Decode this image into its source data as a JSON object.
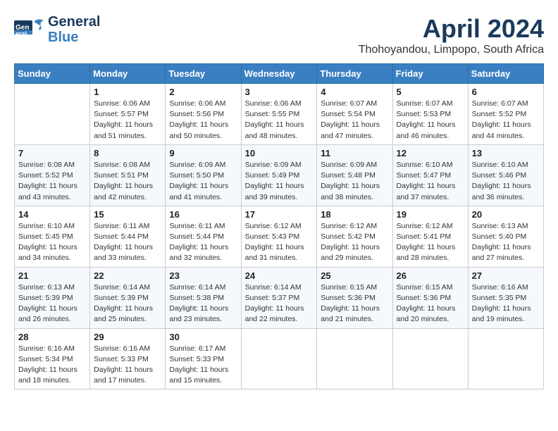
{
  "logo": {
    "line1": "General",
    "line2": "Blue"
  },
  "title": "April 2024",
  "location": "Thohoyandou, Limpopo, South Africa",
  "headers": [
    "Sunday",
    "Monday",
    "Tuesday",
    "Wednesday",
    "Thursday",
    "Friday",
    "Saturday"
  ],
  "weeks": [
    [
      {
        "day": "",
        "info": ""
      },
      {
        "day": "1",
        "info": "Sunrise: 6:06 AM\nSunset: 5:57 PM\nDaylight: 11 hours\nand 51 minutes."
      },
      {
        "day": "2",
        "info": "Sunrise: 6:06 AM\nSunset: 5:56 PM\nDaylight: 11 hours\nand 50 minutes."
      },
      {
        "day": "3",
        "info": "Sunrise: 6:06 AM\nSunset: 5:55 PM\nDaylight: 11 hours\nand 48 minutes."
      },
      {
        "day": "4",
        "info": "Sunrise: 6:07 AM\nSunset: 5:54 PM\nDaylight: 11 hours\nand 47 minutes."
      },
      {
        "day": "5",
        "info": "Sunrise: 6:07 AM\nSunset: 5:53 PM\nDaylight: 11 hours\nand 46 minutes."
      },
      {
        "day": "6",
        "info": "Sunrise: 6:07 AM\nSunset: 5:52 PM\nDaylight: 11 hours\nand 44 minutes."
      }
    ],
    [
      {
        "day": "7",
        "info": "Sunrise: 6:08 AM\nSunset: 5:52 PM\nDaylight: 11 hours\nand 43 minutes."
      },
      {
        "day": "8",
        "info": "Sunrise: 6:08 AM\nSunset: 5:51 PM\nDaylight: 11 hours\nand 42 minutes."
      },
      {
        "day": "9",
        "info": "Sunrise: 6:09 AM\nSunset: 5:50 PM\nDaylight: 11 hours\nand 41 minutes."
      },
      {
        "day": "10",
        "info": "Sunrise: 6:09 AM\nSunset: 5:49 PM\nDaylight: 11 hours\nand 39 minutes."
      },
      {
        "day": "11",
        "info": "Sunrise: 6:09 AM\nSunset: 5:48 PM\nDaylight: 11 hours\nand 38 minutes."
      },
      {
        "day": "12",
        "info": "Sunrise: 6:10 AM\nSunset: 5:47 PM\nDaylight: 11 hours\nand 37 minutes."
      },
      {
        "day": "13",
        "info": "Sunrise: 6:10 AM\nSunset: 5:46 PM\nDaylight: 11 hours\nand 36 minutes."
      }
    ],
    [
      {
        "day": "14",
        "info": "Sunrise: 6:10 AM\nSunset: 5:45 PM\nDaylight: 11 hours\nand 34 minutes."
      },
      {
        "day": "15",
        "info": "Sunrise: 6:11 AM\nSunset: 5:44 PM\nDaylight: 11 hours\nand 33 minutes."
      },
      {
        "day": "16",
        "info": "Sunrise: 6:11 AM\nSunset: 5:44 PM\nDaylight: 11 hours\nand 32 minutes."
      },
      {
        "day": "17",
        "info": "Sunrise: 6:12 AM\nSunset: 5:43 PM\nDaylight: 11 hours\nand 31 minutes."
      },
      {
        "day": "18",
        "info": "Sunrise: 6:12 AM\nSunset: 5:42 PM\nDaylight: 11 hours\nand 29 minutes."
      },
      {
        "day": "19",
        "info": "Sunrise: 6:12 AM\nSunset: 5:41 PM\nDaylight: 11 hours\nand 28 minutes."
      },
      {
        "day": "20",
        "info": "Sunrise: 6:13 AM\nSunset: 5:40 PM\nDaylight: 11 hours\nand 27 minutes."
      }
    ],
    [
      {
        "day": "21",
        "info": "Sunrise: 6:13 AM\nSunset: 5:39 PM\nDaylight: 11 hours\nand 26 minutes."
      },
      {
        "day": "22",
        "info": "Sunrise: 6:14 AM\nSunset: 5:39 PM\nDaylight: 11 hours\nand 25 minutes."
      },
      {
        "day": "23",
        "info": "Sunrise: 6:14 AM\nSunset: 5:38 PM\nDaylight: 11 hours\nand 23 minutes."
      },
      {
        "day": "24",
        "info": "Sunrise: 6:14 AM\nSunset: 5:37 PM\nDaylight: 11 hours\nand 22 minutes."
      },
      {
        "day": "25",
        "info": "Sunrise: 6:15 AM\nSunset: 5:36 PM\nDaylight: 11 hours\nand 21 minutes."
      },
      {
        "day": "26",
        "info": "Sunrise: 6:15 AM\nSunset: 5:36 PM\nDaylight: 11 hours\nand 20 minutes."
      },
      {
        "day": "27",
        "info": "Sunrise: 6:16 AM\nSunset: 5:35 PM\nDaylight: 11 hours\nand 19 minutes."
      }
    ],
    [
      {
        "day": "28",
        "info": "Sunrise: 6:16 AM\nSunset: 5:34 PM\nDaylight: 11 hours\nand 18 minutes."
      },
      {
        "day": "29",
        "info": "Sunrise: 6:16 AM\nSunset: 5:33 PM\nDaylight: 11 hours\nand 17 minutes."
      },
      {
        "day": "30",
        "info": "Sunrise: 6:17 AM\nSunset: 5:33 PM\nDaylight: 11 hours\nand 15 minutes."
      },
      {
        "day": "",
        "info": ""
      },
      {
        "day": "",
        "info": ""
      },
      {
        "day": "",
        "info": ""
      },
      {
        "day": "",
        "info": ""
      }
    ]
  ]
}
